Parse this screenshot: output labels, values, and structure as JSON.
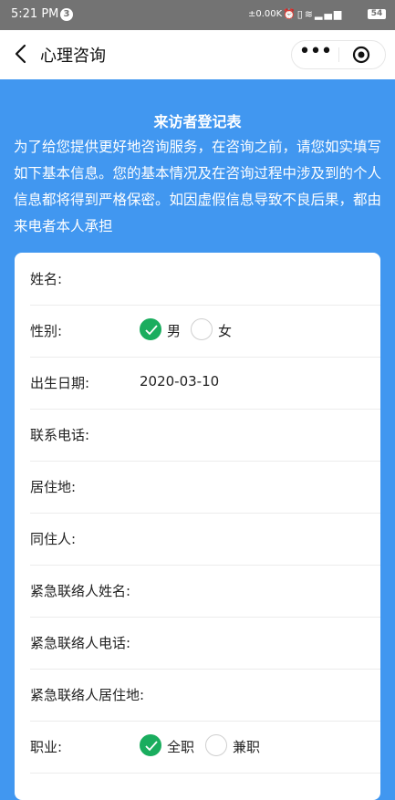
{
  "status_bar": {
    "time": "5:21 PM",
    "notification_count": "3",
    "network_speed": "±0.00K",
    "battery": "54"
  },
  "nav": {
    "title": "心理咨询"
  },
  "intro": {
    "title": "来访者登记表",
    "text": "为了给您提供更好地咨询服务，在咨询之前，请您如实填写如下基本信息。您的基本情况及在咨询过程中涉及到的个人信息都将得到严格保密。如因虚假信息导致不良后果，都由来电者本人承担"
  },
  "form": {
    "name_label": "姓名:",
    "gender_label": "性别:",
    "gender_options": [
      "男",
      "女"
    ],
    "gender_selected": "男",
    "birthdate_label": "出生日期:",
    "birthdate_value": "2020-03-10",
    "phone_label": "联系电话:",
    "residence_label": "居住地:",
    "cohabitant_label": "同住人:",
    "emergency_name_label": "紧急联络人姓名:",
    "emergency_phone_label": "紧急联络人电话:",
    "emergency_residence_label": "紧急联络人居住地:",
    "job_label": "职业:",
    "job_options": [
      "全职",
      "兼职"
    ],
    "job_selected": "全职"
  },
  "colors": {
    "page_background": "#4197f0",
    "radio_checked": "#1aad5e",
    "status_bar": "#737373"
  }
}
